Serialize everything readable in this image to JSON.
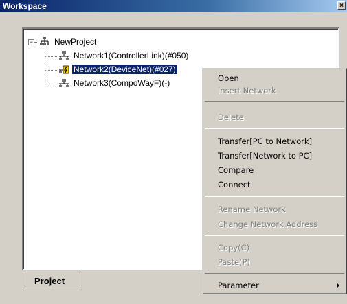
{
  "window": {
    "title": "Workspace",
    "close_glyph": "×"
  },
  "tree": {
    "root": {
      "label": "NewProject",
      "icon": "project-network-icon",
      "expander": "−"
    },
    "children": [
      {
        "label": "Network1(ControllerLink)(#050)",
        "icon": "network-icon"
      },
      {
        "label": "Network2(DeviceNet)(#027)",
        "icon": "network-warning-icon",
        "selected": true
      },
      {
        "label": "Network3(CompoWayF)(-)",
        "icon": "network-icon"
      }
    ]
  },
  "tab": {
    "label": "Project"
  },
  "context_menu": {
    "items": [
      {
        "label": "Open",
        "enabled": true
      },
      {
        "label": "Insert Network",
        "enabled": false
      },
      {
        "label": "Delete",
        "enabled": false
      },
      {
        "label": "Transfer[PC to Network]",
        "enabled": true
      },
      {
        "label": "Transfer[Network to PC]",
        "enabled": true
      },
      {
        "label": "Compare",
        "enabled": true
      },
      {
        "label": "Connect",
        "enabled": true
      },
      {
        "label": "Rename Network",
        "enabled": false
      },
      {
        "label": "Change Network Address",
        "enabled": false
      },
      {
        "label": "Copy(C)",
        "enabled": false
      },
      {
        "label": "Paste(P)",
        "enabled": false
      },
      {
        "label": "Parameter",
        "enabled": true,
        "submenu": true
      }
    ]
  },
  "colors": {
    "selection": "#0a246a",
    "face": "#d4d0c8",
    "disabled_text": "#808080"
  }
}
